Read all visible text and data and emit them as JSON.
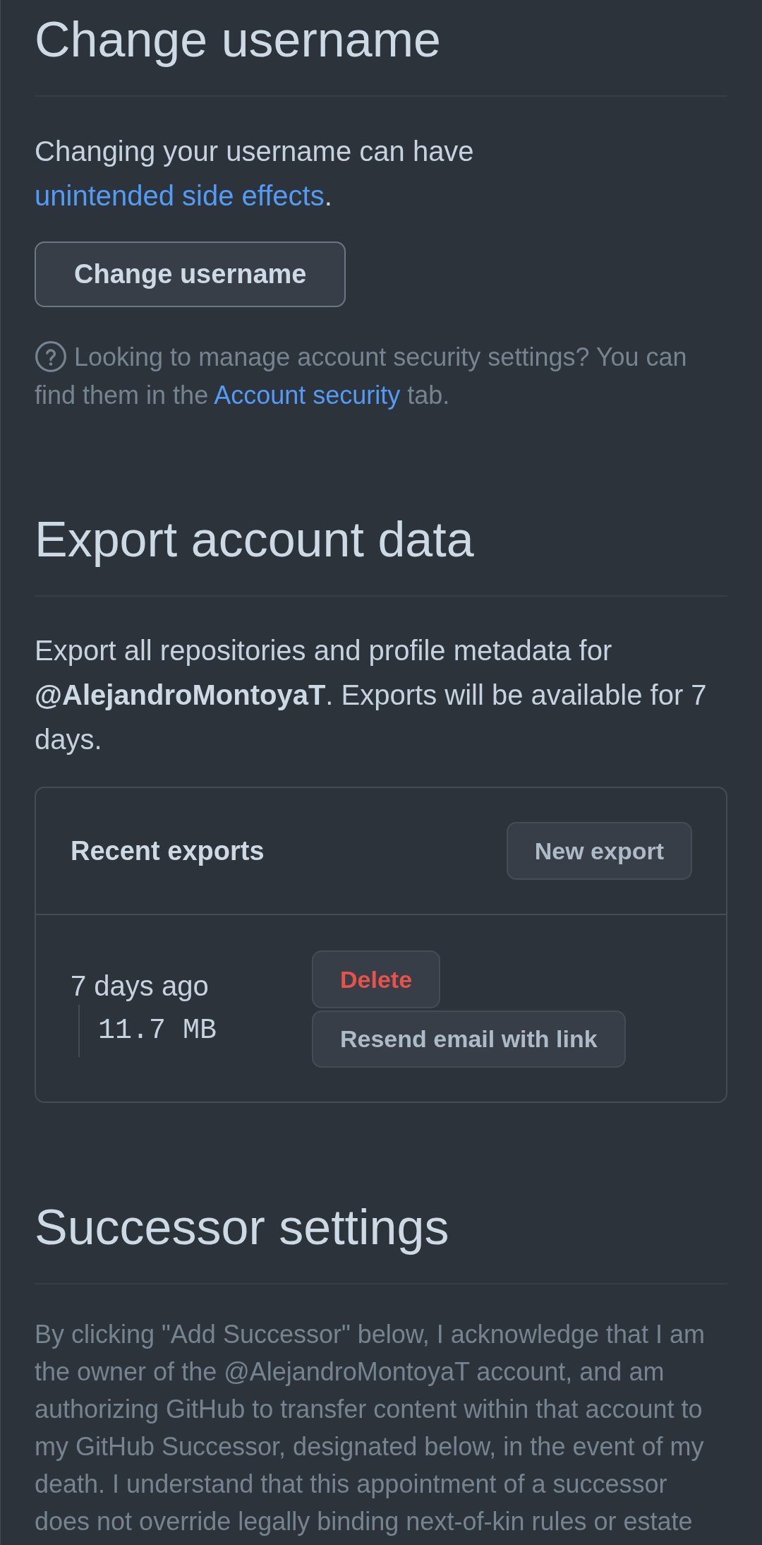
{
  "change_username": {
    "heading": "Change username",
    "notice": {
      "before": "Changing your username can have ",
      "link": "unintended side effects",
      "after": "."
    },
    "button": "Change username",
    "help": {
      "before": "Looking to manage account security settings? You can find them in the ",
      "link": "Account security",
      "after": " tab."
    }
  },
  "export_account_data": {
    "heading": "Export account data",
    "description": "Export all repositories and profile metadata for **@AlejandroMontoyaT**. Exports will be available for 7 days.",
    "recent_exports": {
      "title": "Recent exports",
      "new_button": "New export",
      "items": [
        {
          "age": "7 days ago",
          "size": "11.7 MB",
          "delete_button": "Delete",
          "resend_button": "Resend email with link"
        }
      ]
    }
  },
  "successor_settings": {
    "heading": "Successor settings",
    "description": "By clicking \"Add Successor\" below, I acknowledge that I am the owner of the @AlejandroMontoyaT account, and am authorizing GitHub to transfer content within that account to my GitHub Successor, designated below, in the event of my death. I understand that this appointment of a successor does not override legally binding next-of-kin rules or estate"
  }
}
